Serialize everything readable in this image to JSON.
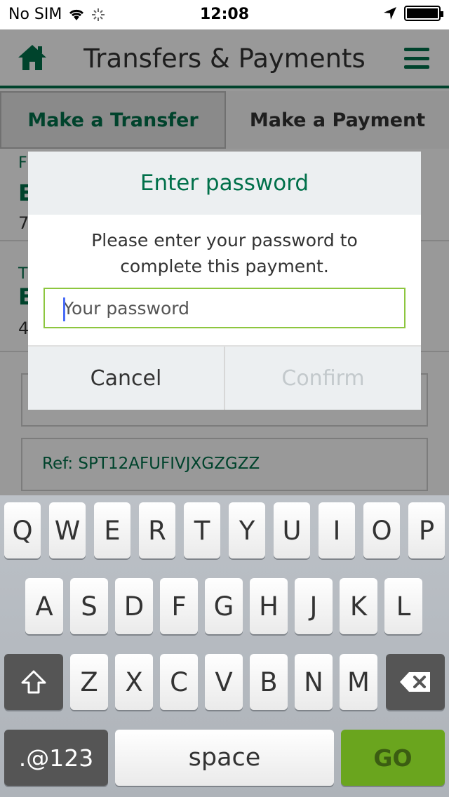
{
  "status": {
    "carrier": "No SIM",
    "time": "12:08"
  },
  "header": {
    "title": "Transfers & Payments"
  },
  "tabs": [
    {
      "label": "Make a Transfer"
    },
    {
      "label": "Make a Payment"
    }
  ],
  "form": {
    "reference": "Ref: SPT12AFUFIVJXGZGZZ"
  },
  "modal": {
    "title": "Enter password",
    "message_line1": "Please enter your password to",
    "message_line2": "complete this payment.",
    "password_placeholder": "Your password",
    "cancel_label": "Cancel",
    "confirm_label": "Confirm"
  },
  "keyboard": {
    "row1": [
      "Q",
      "W",
      "E",
      "R",
      "T",
      "Y",
      "U",
      "I",
      "O",
      "P"
    ],
    "row2": [
      "A",
      "S",
      "D",
      "F",
      "G",
      "H",
      "J",
      "K",
      "L"
    ],
    "row3": [
      "Z",
      "X",
      "C",
      "V",
      "B",
      "N",
      "M"
    ],
    "numbers_label": ".@123",
    "space_label": "space",
    "go_label": "GO"
  },
  "colors": {
    "brand_green": "#00704a",
    "accent_green": "#8dc63f"
  }
}
